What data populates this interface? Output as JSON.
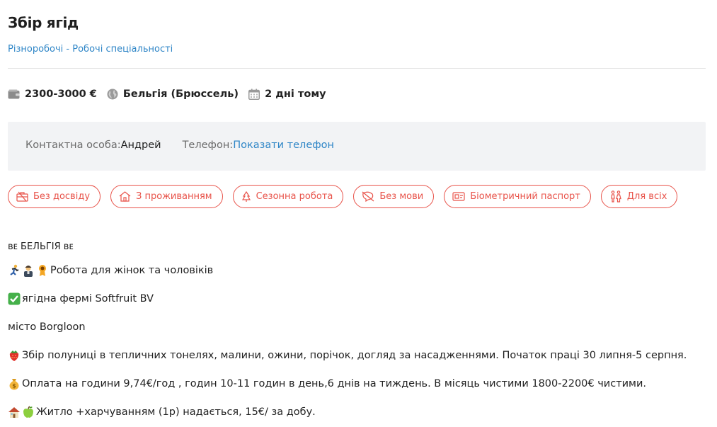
{
  "job": {
    "title": "Збір ягід",
    "category_1": "Різноробочі",
    "category_sep": " - ",
    "category_2": "Робочі спеціальності"
  },
  "meta": {
    "salary": "2300-3000 €",
    "location": "Бельгія (Брюссель)",
    "posted": "2 дні тому"
  },
  "contact": {
    "person_label": "Контактна особа: ",
    "person_name": "Андрей",
    "phone_label": "Телефон: ",
    "phone_link": "Показати телефон"
  },
  "tags": [
    {
      "label": "Без досвіду",
      "icon": "briefcase-icon"
    },
    {
      "label": "З проживанням",
      "icon": "home-icon"
    },
    {
      "label": "Сезонна робота",
      "icon": "tree-icon"
    },
    {
      "label": "Без мови",
      "icon": "no-language-icon"
    },
    {
      "label": "Біометричний паспорт",
      "icon": "passport-icon"
    },
    {
      "label": "Для всіх",
      "icon": "people-icon"
    }
  ],
  "description": {
    "line1": "ʙᴇ БЕЛЬГІЯ ʙᴇ",
    "line2": "Робота для жінок та чоловіків",
    "line3": "ягідна фермі Softfruit BV",
    "line4": "місто Borgloon",
    "line5": "Збір полуниці в тепличних тонелях, малини, ожини, порічок, догляд за насадженнями. Початок праці 30 липня-5 серпня.",
    "line6": "Оплата на години 9,74€/год , годин 10-11 годин в день,6 днів на тиждень. В місяць чистими 1800-2200€ чистими.",
    "line7": "Житло +харчуванням (1р) надається, 15€/ за добу."
  },
  "colors": {
    "accent_link": "#2f86c7",
    "tag_red": "#e8534a",
    "contact_bg": "#f2f3f5"
  }
}
